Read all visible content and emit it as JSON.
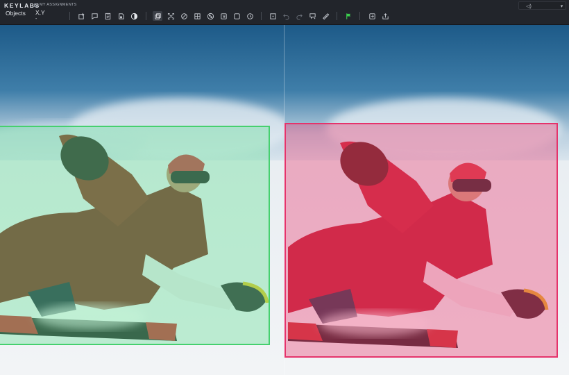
{
  "app": {
    "brand": "KEYLABS",
    "assignments_label": "MY ASSIGNMENTS"
  },
  "panel_tabs": {
    "objects": "Objects",
    "xy": "X,Y",
    "xy_sub": "-"
  },
  "toolbar": {
    "groups": [
      [
        "new-object-icon",
        "comment-icon",
        "notes-icon",
        "save-icon",
        "contrast-icon"
      ],
      [
        "copy-icon",
        "fit-icon",
        "brush-icon",
        "grid-icon",
        "checker-icon",
        "keyboard-icon",
        "frame-icon",
        "history-icon"
      ],
      [
        "select-icon",
        "undo-icon",
        "redo-icon",
        "feedback-icon",
        "ruler-icon"
      ],
      [
        "flag-icon"
      ],
      [
        "export-icon",
        "share-icon"
      ]
    ],
    "accent_flag_color": "#3ccf4e"
  },
  "window": {
    "volume_symbol": "◁)",
    "dropdown_symbol": "▾"
  },
  "annotations": [
    {
      "pane": "left",
      "color": "#46d06f",
      "fill": "rgba(100,224,150,0.38)"
    },
    {
      "pane": "right",
      "color": "#e5336b",
      "fill": "rgba(236,70,120,0.40)"
    }
  ]
}
